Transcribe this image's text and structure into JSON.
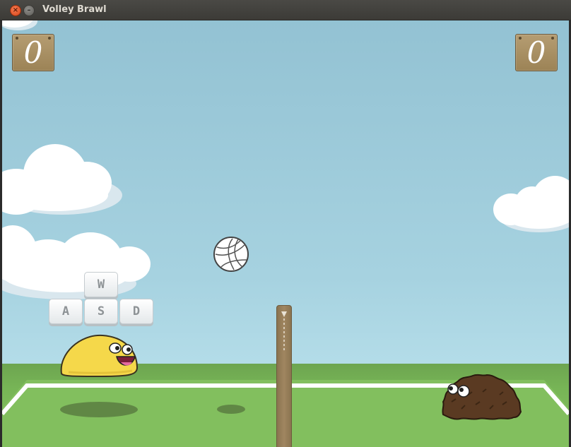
{
  "window": {
    "title": "Volley Brawl",
    "close_icon": "close-icon",
    "minimize_icon": "minimize-icon"
  },
  "game": {
    "score_left": "0",
    "score_right": "0",
    "controls": {
      "up": "W",
      "left": "A",
      "down": "S",
      "right": "D"
    },
    "colors": {
      "sky": "#a6d2e0",
      "grass": "#77b556",
      "court_line": "#ffffff",
      "score_board": "#a68d60",
      "player_left": "#f5d84a",
      "player_right": "#5a3a22"
    }
  }
}
